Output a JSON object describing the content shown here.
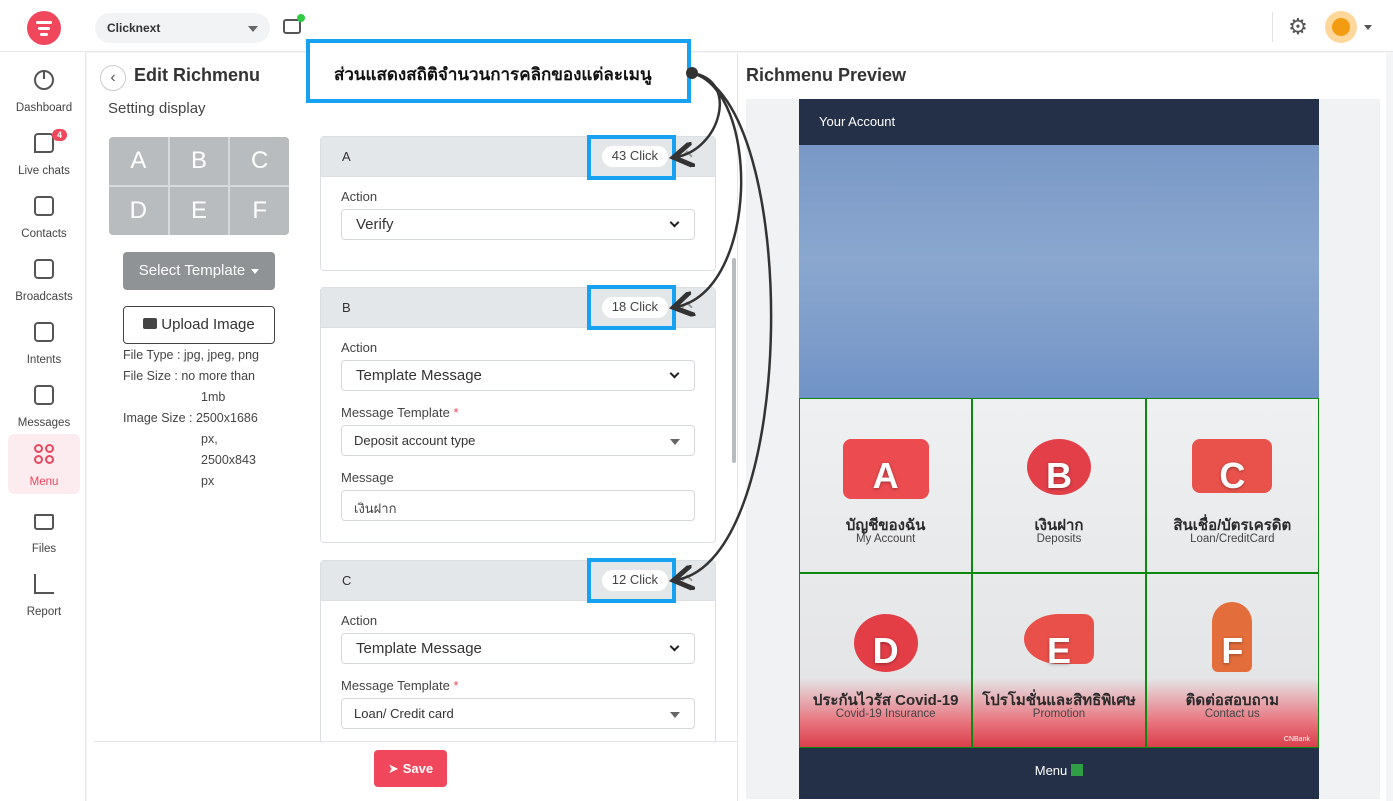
{
  "topbar": {
    "workspace": "Clicknext"
  },
  "sidebar": {
    "items": [
      {
        "label": "Dashboard"
      },
      {
        "label": "Live chats",
        "badge": "4"
      },
      {
        "label": "Contacts"
      },
      {
        "label": "Broadcasts"
      },
      {
        "label": "Intents"
      },
      {
        "label": "Messages"
      },
      {
        "label": "Menu"
      },
      {
        "label": "Files"
      },
      {
        "label": "Report"
      }
    ]
  },
  "edit": {
    "title": "Edit Richmenu",
    "setting_display": "Setting display",
    "layout_cells": [
      "A",
      "B",
      "C",
      "D",
      "E",
      "F"
    ],
    "select_template": "Select Template",
    "upload_image": "Upload Image",
    "file_info": {
      "file_type": "File Type : jpg, jpeg, png",
      "file_size": "File Size : no more than",
      "file_size_cont": "1mb",
      "image_size": "Image Size : 2500x1686",
      "image_size_2": "px,",
      "image_size_3": "2500x843",
      "image_size_4": "px"
    },
    "cards": [
      {
        "letter": "A",
        "clicks": "43 Click",
        "action_label": "Action",
        "action_value": "Verify"
      },
      {
        "letter": "B",
        "clicks": "18 Click",
        "action_label": "Action",
        "action_value": "Template Message",
        "template_label": "Message Template",
        "template_value": "Deposit account type",
        "message_label": "Message",
        "message_value": "เงินฝาก"
      },
      {
        "letter": "C",
        "clicks": "12 Click",
        "action_label": "Action",
        "action_value": "Template Message",
        "template_label": "Message Template",
        "template_value": "Loan/ Credit card"
      }
    ],
    "save": "Save"
  },
  "preview": {
    "title": "Richmenu Preview",
    "account": "Your Account",
    "cells": [
      {
        "letter": "A",
        "th": "บัญชีของฉัน",
        "en": "My Account"
      },
      {
        "letter": "B",
        "th": "เงินฝาก",
        "en": "Deposits"
      },
      {
        "letter": "C",
        "th": "สินเชื่อ/บัตรเครดิต",
        "en": "Loan/CreditCard"
      },
      {
        "letter": "D",
        "th": "ประกันไวรัส Covid-19",
        "en": "Covid-19 Insurance"
      },
      {
        "letter": "E",
        "th": "โปรโมชั่นและสิทธิพิเศษ",
        "en": "Promotion"
      },
      {
        "letter": "F",
        "th": "ติดต่อสอบถาม",
        "en": "Contact us"
      }
    ],
    "bank_mark": "CNBank",
    "menu_label": "Menu"
  },
  "annotation": {
    "callout": "ส่วนแสดงสถิติจำนวนการคลิกของแต่ละเมนู",
    "accent": "#16a1f1"
  },
  "colors": {
    "brand": "#f0475c",
    "cell_border": "#0d8a0d",
    "phone_dark": "#233047"
  }
}
